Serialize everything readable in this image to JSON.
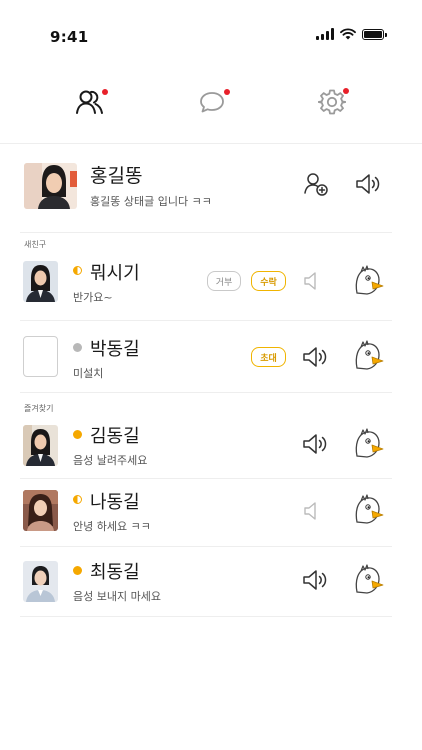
{
  "status_bar": {
    "time": "9:41"
  },
  "tabs": [
    {
      "icon": "friends-icon",
      "has_badge": true
    },
    {
      "icon": "chat-icon",
      "has_badge": true
    },
    {
      "icon": "settings-icon",
      "has_badge": true
    }
  ],
  "me": {
    "name": "홍길똥",
    "status_message": "홍길똥 상태글 입니다 ㅋㅋ"
  },
  "sections": {
    "new_friends": "새친구",
    "favorites": "즐겨찾기"
  },
  "friends": [
    {
      "name": "뭐시기",
      "status_message": "반가요~",
      "presence": "away",
      "actions": {
        "reject": "거부",
        "accept": "수락"
      },
      "voice": "off"
    },
    {
      "name": "박동길",
      "status_message": "미설치",
      "presence": "offline",
      "actions": {
        "invite": "초대"
      },
      "voice": "on"
    },
    {
      "name": "김동길",
      "status_message": "음성 날려주세요",
      "presence": "online",
      "voice": "on"
    },
    {
      "name": "나동길",
      "status_message": "안녕 하세요 ㅋㅋ",
      "presence": "away",
      "voice": "off"
    },
    {
      "name": "최동길",
      "status_message": "음성 보내지 마세요",
      "presence": "online",
      "voice": "on"
    }
  ],
  "colors": {
    "accent": "#f5a800",
    "badge": "#e8202a",
    "offline": "#b8b8b8"
  }
}
